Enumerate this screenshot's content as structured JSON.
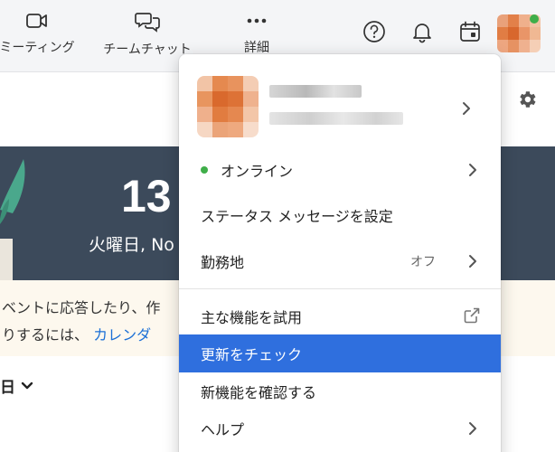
{
  "toolbar": {
    "meeting_label": "ミーティング",
    "chat_label": "チームチャット",
    "more_label": "詳細"
  },
  "banner": {
    "date": "13",
    "weekday": "火曜日, No"
  },
  "notice": {
    "line1": "ベントに応答したり、作",
    "line2_prefix": "りするには、",
    "line2_link": "カレンダ"
  },
  "day_select": {
    "label": "日"
  },
  "menu": {
    "status": {
      "label": "オンライン",
      "color": "#3fae49"
    },
    "status_message": "ステータス メッセージを設定",
    "work_location": {
      "label": "勤務地",
      "value": "オフ"
    },
    "try_features": "主な機能を試用",
    "check_updates": "更新をチェック",
    "whats_new": "新機能を確認する",
    "help": "ヘルプ"
  },
  "colors": {
    "accent": "#2f6fde",
    "banner_bg": "#3c4a5b",
    "link": "#1a6fd6",
    "online": "#3fae49"
  },
  "icons": [
    "video-camera-icon",
    "chat-bubbles-icon",
    "more-dots-icon",
    "help-icon",
    "bell-icon",
    "calendar-icon",
    "gear-icon",
    "chevron-right-icon",
    "external-link-icon",
    "chevron-down-icon"
  ]
}
